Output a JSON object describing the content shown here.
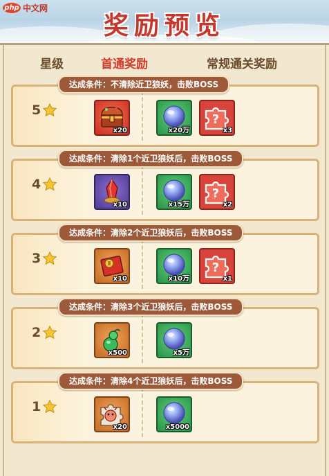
{
  "watermark": {
    "mark": "php",
    "text": "中文网"
  },
  "title": "奖励预览",
  "columns": {
    "star": "星级",
    "first_clear": "首通奖励",
    "normal_clear": "常规通关奖励"
  },
  "rows": [
    {
      "stars": "5",
      "condition": "达成条件：不清除近卫狼妖，击败BOSS",
      "first": {
        "icon": "treasure-chest-icon",
        "qty": "x20"
      },
      "normal": [
        {
          "icon": "blue-orb-icon",
          "qty": "x20万"
        },
        {
          "icon": "mystery-puzzle-icon",
          "qty": "x3"
        }
      ]
    },
    {
      "stars": "4",
      "condition": "达成条件：清除1个近卫狼妖后，击败BOSS",
      "first": {
        "icon": "red-crystal-icon",
        "qty": "x10"
      },
      "normal": [
        {
          "icon": "blue-orb-icon",
          "qty": "x15万"
        },
        {
          "icon": "mystery-puzzle-icon",
          "qty": "x2"
        }
      ]
    },
    {
      "stars": "3",
      "condition": "达成条件：清除2个近卫狼妖后，击败BOSS",
      "first": {
        "icon": "red-envelope-icon",
        "qty": "x10"
      },
      "normal": [
        {
          "icon": "blue-orb-icon",
          "qty": "x10万"
        },
        {
          "icon": "mystery-puzzle-icon",
          "qty": "x1"
        }
      ]
    },
    {
      "stars": "2",
      "condition": "达成条件：清除3个近卫狼妖后，击败BOSS",
      "first": {
        "icon": "green-gourd-icon",
        "qty": "x500"
      },
      "normal": [
        {
          "icon": "blue-orb-icon",
          "qty": "x5万"
        }
      ]
    },
    {
      "stars": "1",
      "condition": "达成条件：清除4个近卫狼妖后，击败BOSS",
      "first": {
        "icon": "monster-puzzle-icon",
        "qty": "x20"
      },
      "normal": [
        {
          "icon": "blue-orb-icon",
          "qty": "x5000"
        }
      ]
    }
  ],
  "colors": {
    "title_red": "#c4372d",
    "first_clear_red": "#d23b2a",
    "badge_brown": "#9c5a3a",
    "star_gold": "#f5c431"
  }
}
